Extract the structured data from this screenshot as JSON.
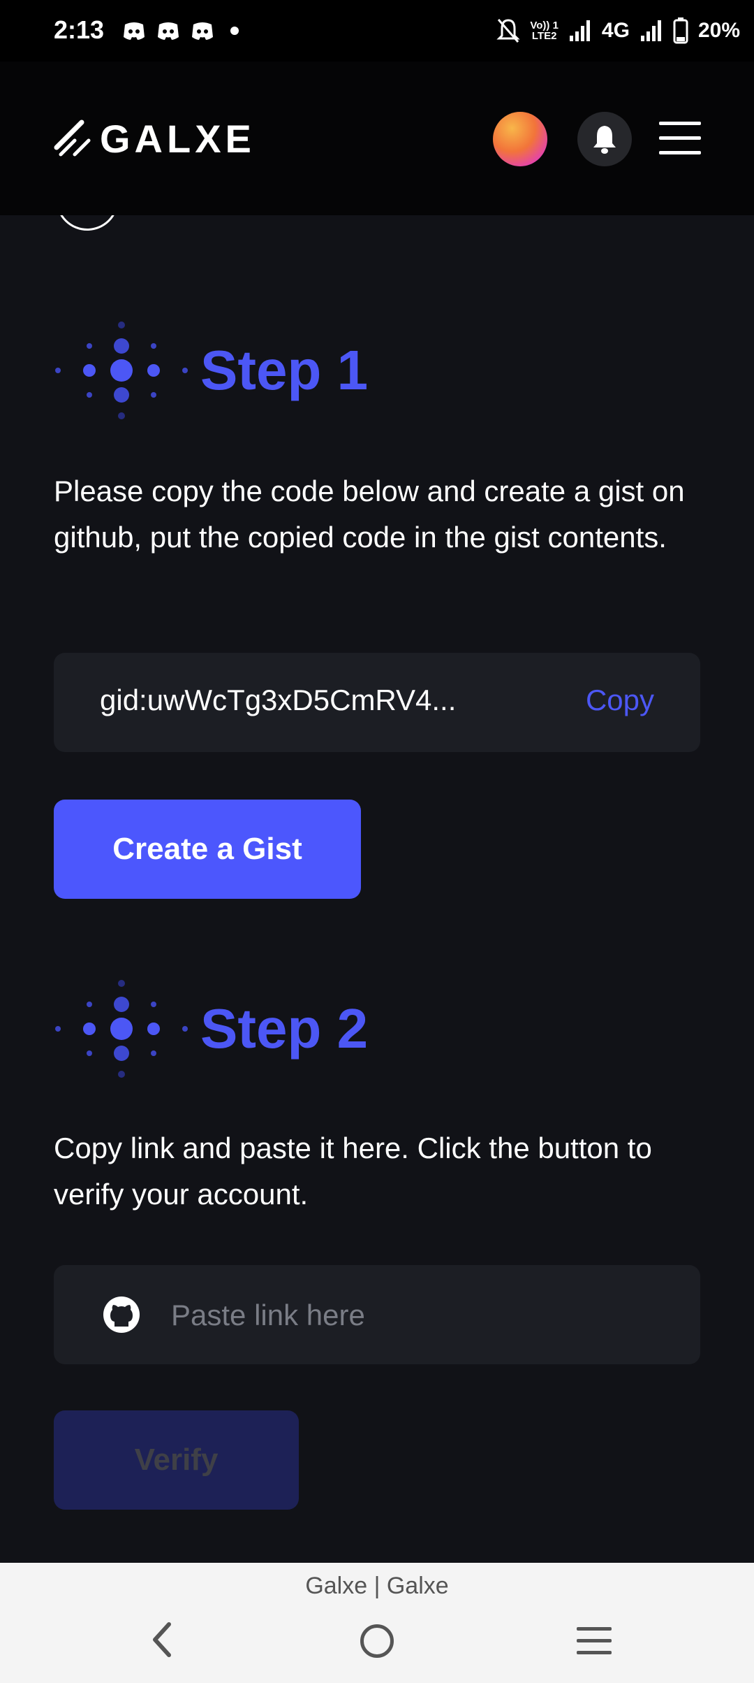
{
  "status_bar": {
    "time": "2:13",
    "network": "4G",
    "volte": "Vo)) 1",
    "lte": "LTE2",
    "battery": "20%"
  },
  "header": {
    "brand": "GALXE",
    "icons": [
      "avatar",
      "bell-icon",
      "menu-icon"
    ]
  },
  "step1": {
    "title": "Step 1",
    "description": "Please copy the code below and create a gist on github, put the copied code in the gist contents.",
    "code": "gid:uwWcTg3xD5CmRV4...",
    "copy_label": "Copy",
    "button_label": "Create a Gist"
  },
  "step2": {
    "title": "Step 2",
    "description": "Copy link and paste it here. Click the button to verify your account.",
    "input_placeholder": "Paste link here",
    "button_label": "Verify"
  },
  "bottom_bar": {
    "page_title": "Galxe | Galxe"
  },
  "colors": {
    "accent": "#4c57f5",
    "background": "#111217",
    "panel": "#1c1e24"
  }
}
